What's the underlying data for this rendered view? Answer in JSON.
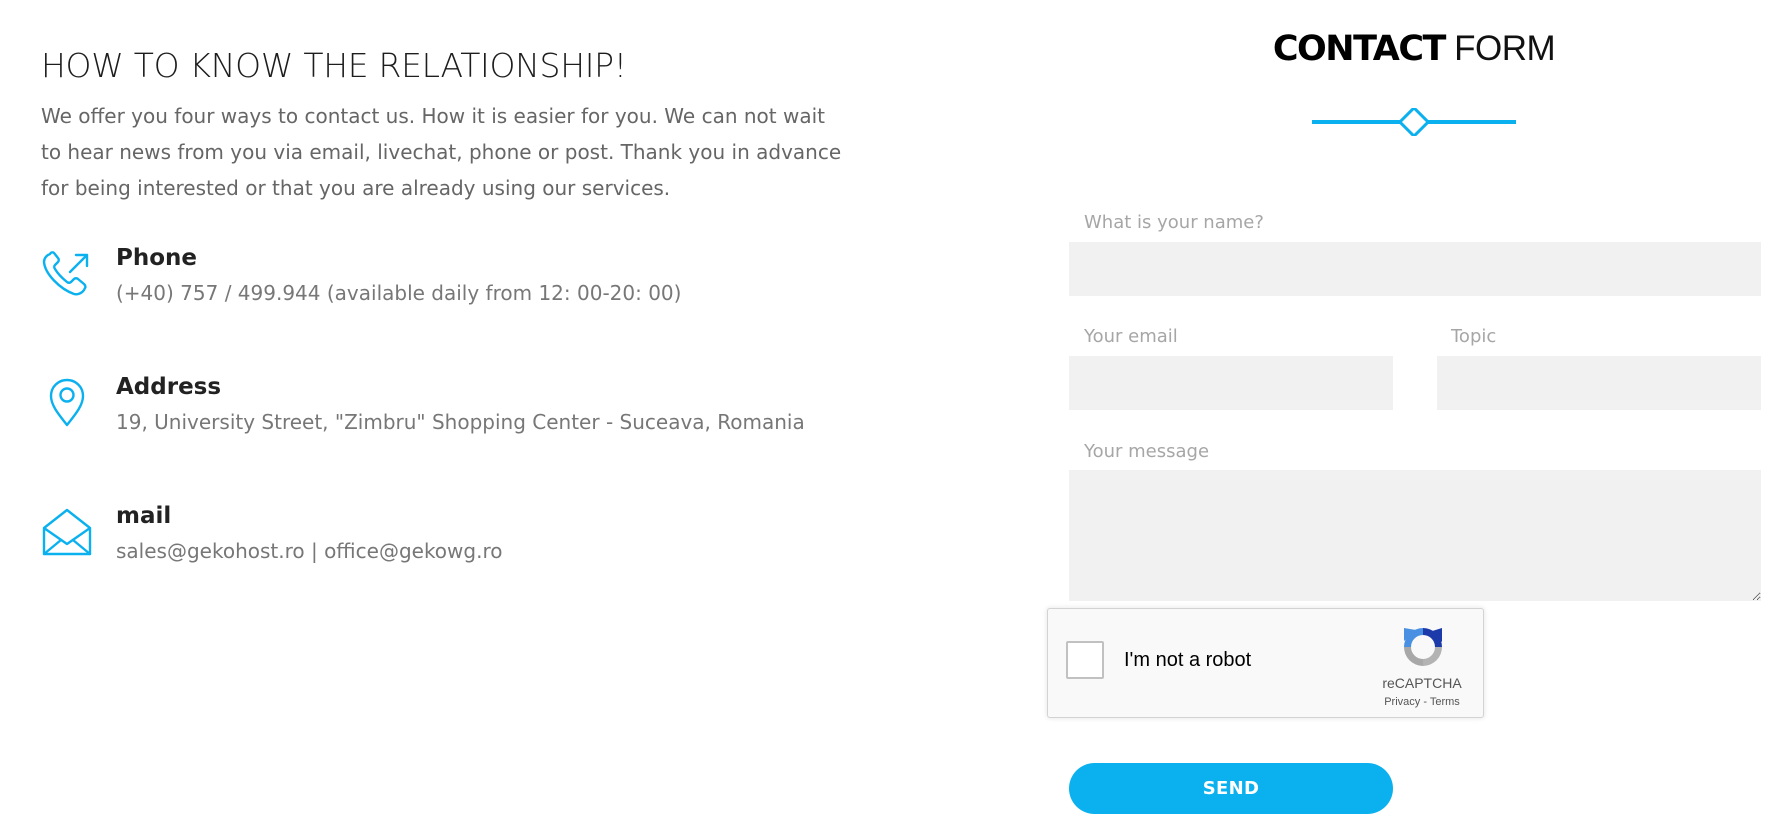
{
  "left": {
    "heading": "HOW TO KNOW THE RELATIONSHIP!",
    "intro": "We offer you four ways to contact us. How it is easier for you. We can not wait to hear news from you via email, livechat, phone or post. Thank you in advance for being interested or that you are already using our services.",
    "contacts": [
      {
        "icon": "phone-icon",
        "label": "Phone",
        "value": "(+40) 757 / 499.944 (available daily from 12: 00-20: 00)"
      },
      {
        "icon": "location-pin-icon",
        "label": "Address",
        "value": "19, University Street, \"Zimbru\" Shopping Center - Suceava, Romania"
      },
      {
        "icon": "envelope-open-icon",
        "label": "mail",
        "value": "sales@gekohost.ro | office@gekowg.ro"
      }
    ]
  },
  "form": {
    "title_strong": "CONTACT",
    "title_light": " FORM",
    "name_label": "What is your name?",
    "name_value": "",
    "email_label": "Your email",
    "email_value": "",
    "topic_label": "Topic",
    "topic_value": "",
    "message_label": "Your message",
    "message_value": "",
    "captcha": {
      "text": "I'm not a robot",
      "brand": "reCAPTCHA",
      "privacy": "Privacy",
      "separator": " - ",
      "terms": "Terms"
    },
    "send_label": "SEND"
  },
  "colors": {
    "accent": "#0bb1ef",
    "field_bg": "#f1f1f1",
    "label_gray": "#a6a6a6"
  }
}
